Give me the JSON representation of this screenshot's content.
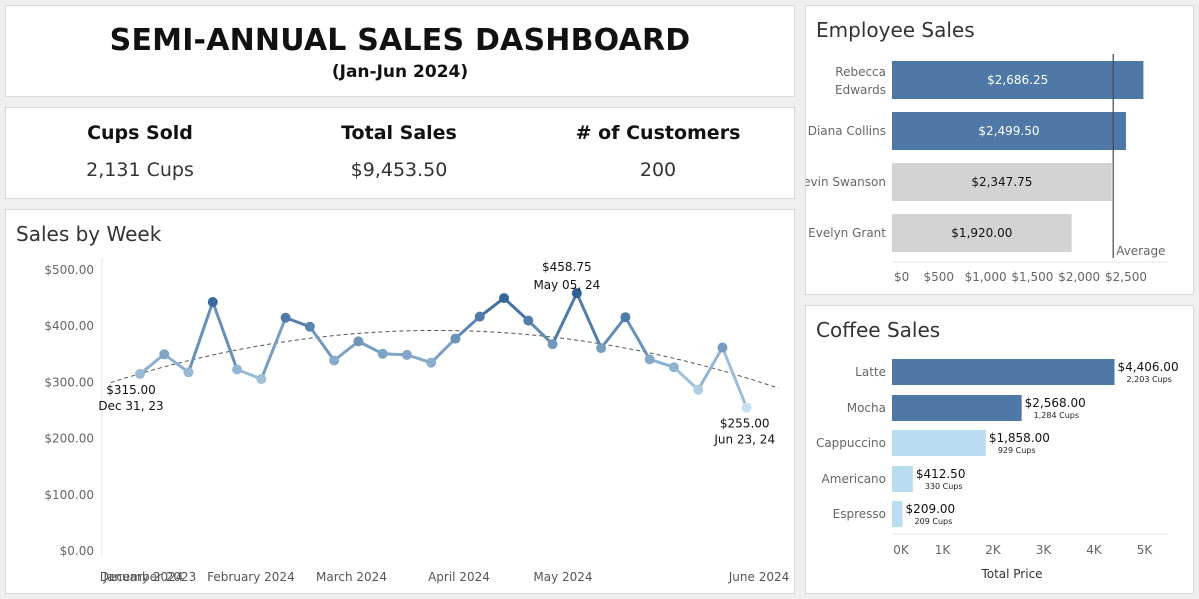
{
  "dashboard": {
    "title": "SEMI-ANNUAL SALES DASHBOARD",
    "subtitle": "(Jan-Jun 2024)"
  },
  "kpis": [
    {
      "label": "Cups Sold",
      "value": "2,131 Cups"
    },
    {
      "label": "Total Sales",
      "value": "$9,453.50"
    },
    {
      "label": "# of Customers",
      "value": "200"
    }
  ],
  "chart_data": [
    {
      "type": "line",
      "title": "Sales by Week",
      "xlabel": "",
      "ylabel": "",
      "ylim": [
        0,
        500
      ],
      "yticks": [
        "$0.00",
        "$100.00",
        "$200.00",
        "$300.00",
        "$400.00",
        "$500.00"
      ],
      "x_month_labels": [
        "December 2023",
        "January 2024",
        "February 2024",
        "March 2024",
        "April 2024",
        "May 2024",
        "June 2024"
      ],
      "trend_line": "polynomial (dashed)",
      "point_color_scale": [
        "#c6e1f1",
        "#2e5f94"
      ],
      "grid": false,
      "series": [
        {
          "x": [
            "2023-12-31",
            "2024-01-07",
            "2024-01-14",
            "2024-01-21",
            "2024-01-28",
            "2024-02-04",
            "2024-02-11",
            "2024-02-18",
            "2024-02-25",
            "2024-03-03",
            "2024-03-10",
            "2024-03-17",
            "2024-03-24",
            "2024-03-31",
            "2024-04-07",
            "2024-04-14",
            "2024-04-21",
            "2024-04-28",
            "2024-05-05",
            "2024-05-12",
            "2024-05-19",
            "2024-05-26",
            "2024-06-02",
            "2024-06-09",
            "2024-06-16",
            "2024-06-23"
          ],
          "values": [
            315,
            350,
            318,
            443,
            323,
            306,
            415,
            399,
            339,
            373,
            351,
            349,
            335,
            378,
            417,
            450,
            410,
            368,
            458.75,
            361,
            416,
            341,
            327,
            287,
            362,
            255
          ]
        }
      ],
      "annotations": [
        {
          "value": "$315.00",
          "date": "Dec 31, 23"
        },
        {
          "value": "$458.75",
          "date": "May 05, 24"
        },
        {
          "value": "$255.00",
          "date": "Jun 23, 24"
        }
      ]
    },
    {
      "type": "bar",
      "orientation": "horizontal",
      "title": "Employee Sales",
      "categories": [
        "Rebecca Edwards",
        "Diana Collins",
        "Kevin Swanson",
        "Evelyn Grant"
      ],
      "values": [
        2686.25,
        2499.5,
        2347.75,
        1920.0
      ],
      "value_labels": [
        "$2,686.25",
        "$2,499.50",
        "$2,347.75",
        "$1,920.00"
      ],
      "colors": [
        "#4e79a7",
        "#4e79a7",
        "#d3d3d3",
        "#d3d3d3"
      ],
      "xlim": [
        0,
        2863.4
      ],
      "xticks": [
        "$0",
        "$500",
        "$1,000",
        "$1,500",
        "$2,000",
        "$2,500"
      ],
      "reference_line": {
        "label": "Average",
        "value": 2363.375
      },
      "grid": false
    },
    {
      "type": "bar",
      "orientation": "horizontal",
      "title": "Coffee Sales",
      "xlabel": "Total Price",
      "categories": [
        "Latte",
        "Mocha",
        "Cappuccino",
        "Americano",
        "Espresso"
      ],
      "values": [
        4406.0,
        2568.0,
        1858.0,
        412.5,
        209.0
      ],
      "value_labels": [
        "$4,406.00",
        "$2,568.00",
        "$1,858.00",
        "$412.50",
        "$209.00"
      ],
      "cups_labels": [
        "2,203 Cups",
        "1,284 Cups",
        "929 Cups",
        "330 Cups",
        "209 Cups"
      ],
      "colors": [
        "#4e79a7",
        "#4e79a7",
        "#b9dcf0",
        "#b9dcf0",
        "#b9dcf0"
      ],
      "xlim": [
        0,
        5500
      ],
      "xticks": [
        "0K",
        "1K",
        "2K",
        "3K",
        "4K",
        "5K"
      ],
      "grid": false
    }
  ]
}
